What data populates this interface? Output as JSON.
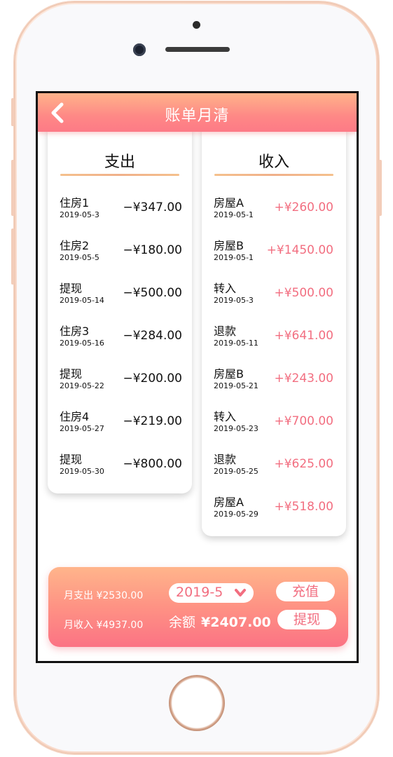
{
  "header": {
    "title": "账单月清"
  },
  "expense": {
    "title": "支出",
    "items": [
      {
        "name": "住房1",
        "date": "2019-05-3",
        "amount": "−¥347.00"
      },
      {
        "name": "住房2",
        "date": "2019-05-5",
        "amount": "−¥180.00"
      },
      {
        "name": "提现",
        "date": "2019-05-14",
        "amount": "−¥500.00"
      },
      {
        "name": "住房3",
        "date": "2019-05-16",
        "amount": "−¥284.00"
      },
      {
        "name": "提现",
        "date": "2019-05-22",
        "amount": "−¥200.00"
      },
      {
        "name": "住房4",
        "date": "2019-05-27",
        "amount": "−¥219.00"
      },
      {
        "name": "提现",
        "date": "2019-05-30",
        "amount": "−¥800.00"
      }
    ]
  },
  "income": {
    "title": "收入",
    "items": [
      {
        "name": "房屋A",
        "date": "2019-05-1",
        "amount": "+¥260.00"
      },
      {
        "name": "房屋B",
        "date": "2019-05-1",
        "amount": "+¥1450.00"
      },
      {
        "name": "转入",
        "date": "2019-05-3",
        "amount": "+¥500.00"
      },
      {
        "name": "退款",
        "date": "2019-05-11",
        "amount": "+¥641.00"
      },
      {
        "name": "房屋B",
        "date": "2019-05-21",
        "amount": "+¥243.00"
      },
      {
        "name": "转入",
        "date": "2019-05-23",
        "amount": "+¥700.00"
      },
      {
        "name": "退款",
        "date": "2019-05-25",
        "amount": "+¥625.00"
      },
      {
        "name": "房屋A",
        "date": "2019-05-29",
        "amount": "+¥518.00"
      }
    ]
  },
  "summary": {
    "month_expense": "月支出 ¥2530.00",
    "month_income": "月收入 ¥4937.00",
    "month_selected": "2019-5",
    "balance_label": "余额",
    "balance_value": "¥2407.00",
    "recharge_label": "充值",
    "withdraw_label": "提现"
  },
  "colors": {
    "accent": "#f26e80",
    "header_gradient_top": "#ffb38a",
    "header_gradient_bottom": "#fd7a86",
    "divider": "#f0b08a"
  },
  "icons": {
    "back": "chevron-left-icon",
    "dropdown": "chevron-down-icon"
  }
}
